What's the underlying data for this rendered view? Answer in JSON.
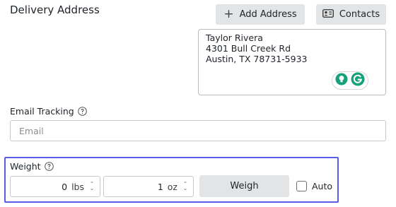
{
  "delivery": {
    "title": "Delivery Address",
    "add_address_label": "Add Address",
    "contacts_label": "Contacts",
    "address_lines": [
      "Taylor Rivera",
      "4301 Bull Creek Rd",
      "Austin, TX 78731-5933"
    ]
  },
  "email": {
    "label": "Email Tracking",
    "placeholder": "Email"
  },
  "weight": {
    "label": "Weight",
    "lbs_value": "0",
    "lbs_unit": "lbs",
    "oz_value": "1",
    "oz_unit": "oz",
    "weigh_label": "Weigh",
    "auto_label": "Auto",
    "auto_checked": false
  },
  "colors": {
    "focus_outline": "#5b5ce6",
    "grammarly_green": "#15a17a"
  }
}
